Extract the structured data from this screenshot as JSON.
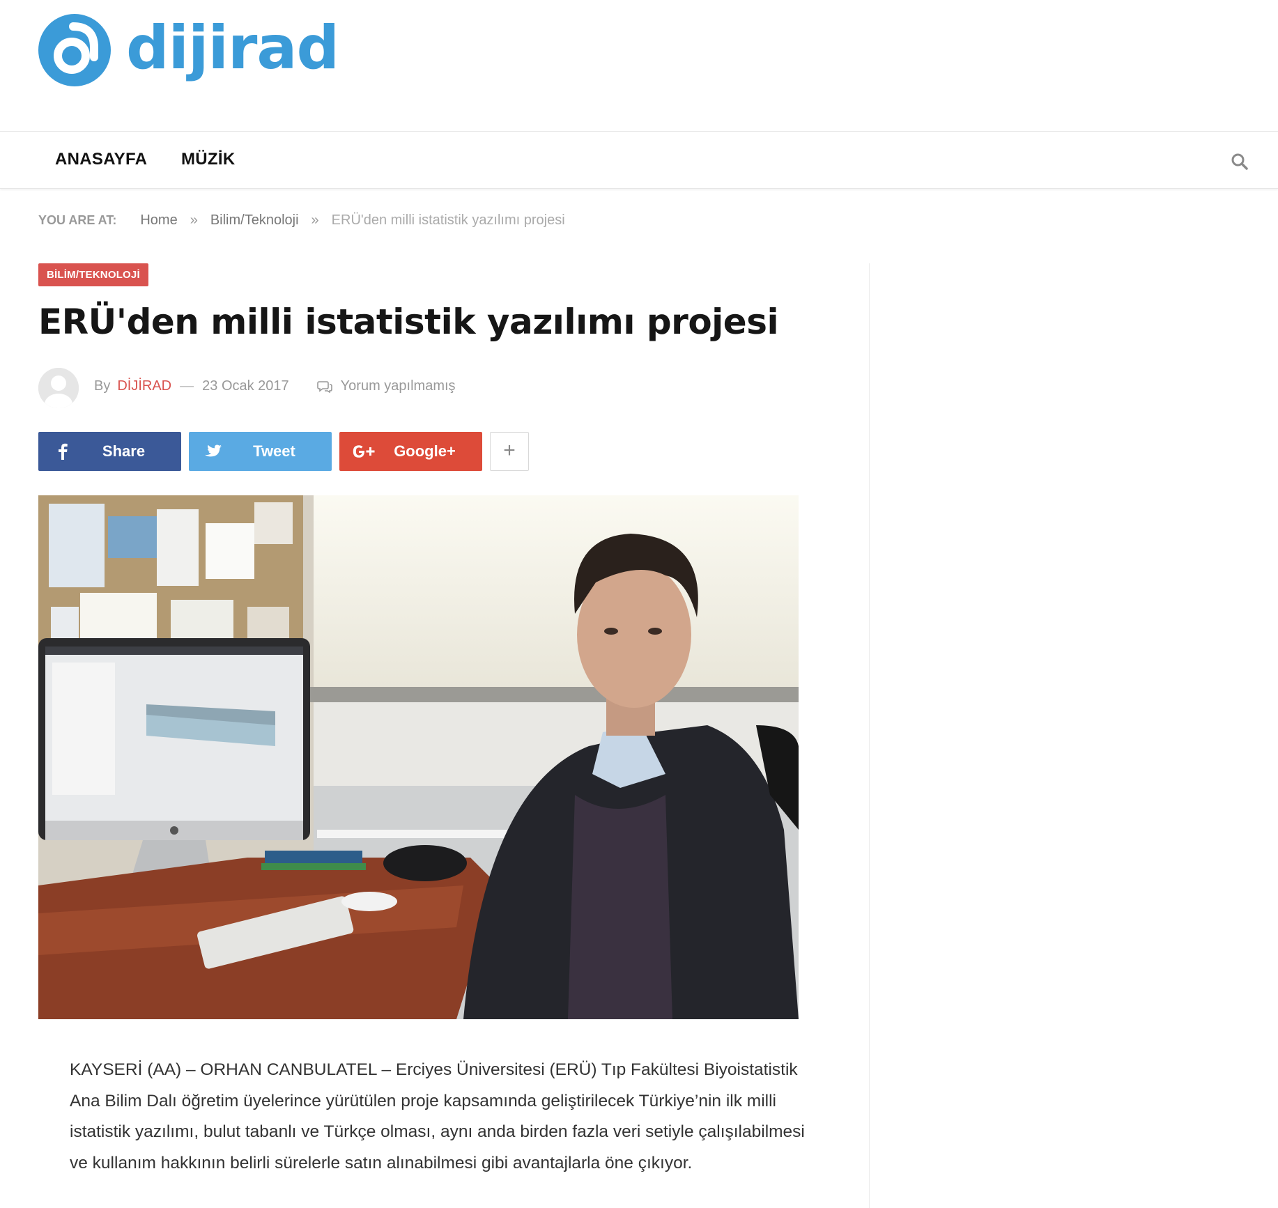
{
  "site": {
    "logo_text": "dijirad",
    "brand_color": "#3b9bd8"
  },
  "nav": {
    "items": [
      "ANASAYFA",
      "MÜZİK"
    ],
    "search_icon": "search-icon"
  },
  "breadcrumb": {
    "label": "YOU ARE AT:",
    "items": [
      "Home",
      "Bilim/Teknoloji",
      "ERÜ'den milli istatistik yazılımı projesi"
    ],
    "separator": "»"
  },
  "article": {
    "category": "BİLİM/TEKNOLOJİ",
    "category_color": "#d9534f",
    "title": "ERÜ'den milli istatistik yazılımı projesi",
    "meta": {
      "by": "By",
      "author": "DİJİRAD",
      "dash": "—",
      "date": "23 Ocak 2017",
      "comments": "Yorum yapılmamış"
    },
    "share": {
      "facebook": "Share",
      "twitter": "Tweet",
      "google": "Google+",
      "more": "+"
    },
    "body": [
      "KAYSERİ (AA) – ORHAN CANBULATEL – Erciyes Üniversitesi (ERÜ) Tıp Fakültesi Biyoistatistik Ana Bilim Dalı öğretim üyelerince yürütülen proje kapsamında geliştirilecek Türkiye’nin ilk milli istatistik yazılımı, bulut tabanlı ve Türkçe olması, aynı anda birden fazla veri setiyle çalışılabilmesi ve kullanım hakkının belirli sürelerle satın alınabilmesi gibi avantajlarla öne çıkıyor."
    ]
  }
}
